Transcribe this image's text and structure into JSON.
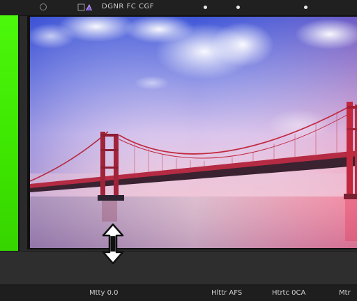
{
  "toolbar": {
    "title": "DGNR FC CGF",
    "icons": [
      "circle-icon",
      "layers-icon"
    ],
    "dots": 3
  },
  "left_panel": {
    "swatch_color": "#43ee05"
  },
  "viewport": {
    "image": "golden-gate-bridge",
    "sky_top": "#4c63d9",
    "sky_bottom": "#f3c6d6",
    "bridge_color": "#c8283c"
  },
  "timeline": {
    "handle_icon": "resize-updown-icon"
  },
  "status": {
    "left": "Mtty 0.0",
    "mid": "Hlttr AFS",
    "mid2": "Htrtc 0CA",
    "right": "Mtr"
  }
}
